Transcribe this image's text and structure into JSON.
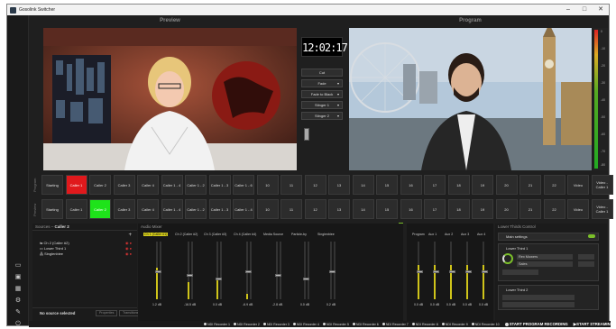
{
  "window": {
    "title": "Gosolink Switcher"
  },
  "controls": {
    "minimize": "–",
    "maximize": "□",
    "close": "✕"
  },
  "panels": {
    "preview": "Preview",
    "program": "Program"
  },
  "clock": "12:02:17",
  "transitions": [
    {
      "label": "Cut",
      "dropdown": false
    },
    {
      "label": "Fade",
      "dropdown": true
    },
    {
      "label": "Fade to Black",
      "dropdown": true
    },
    {
      "label": "Stinger 1",
      "dropdown": true
    },
    {
      "label": "Stinger 2",
      "dropdown": true
    }
  ],
  "vu_ticks": [
    "0",
    "-10",
    "-20",
    "-30",
    "-40",
    "-50",
    "-60",
    "-70",
    "-80"
  ],
  "bus_labels": {
    "program": "Program",
    "preview": "Preview"
  },
  "program_bus": [
    "Starting",
    "Caller 1",
    "Caller 2",
    "Caller 3",
    "Caller 4",
    "Caller 1 - 4",
    "Caller 1 - 2",
    "Caller 1 - 3",
    "Caller 1 - 6",
    "10",
    "11",
    "12",
    "13",
    "14",
    "15",
    "16",
    "17",
    "18",
    "19",
    "20",
    "21",
    "22",
    "Video",
    "Video - Caller 1"
  ],
  "preview_bus": [
    "Starting",
    "Caller 1",
    "Caller 2",
    "Caller 3",
    "Caller 4",
    "Caller 1 - 4",
    "Caller 1 - 2",
    "Caller 1 - 3",
    "Caller 1 - 4",
    "10",
    "11",
    "12",
    "13",
    "14",
    "15",
    "16",
    "17",
    "18",
    "19",
    "20",
    "21",
    "22",
    "Video",
    "Video - Caller 1"
  ],
  "active": {
    "program_index": 1,
    "preview_index": 2,
    "colors": {
      "program": "#e0191c",
      "preview": "#1ee31a"
    }
  },
  "sources": {
    "header": "Sources – ",
    "scene": "Caller 2",
    "add": "+",
    "items": [
      "Ch 2 (Caller #2)",
      "Lower Third 1",
      "Singlenbiee"
    ]
  },
  "no_source": "No source selected",
  "prop_buttons": [
    "Properties",
    "Transitions"
  ],
  "mixer": {
    "header": "Audio Mixer",
    "channels": [
      {
        "name": "Ch 1 (Caller #1)",
        "db": "1.2 dB",
        "level": 0.55
      },
      {
        "name": "Ch 2 (Caller #2)",
        "db": "-16.5 dB",
        "level": 0.3
      },
      {
        "name": "Ch 3 (Caller #3)",
        "db": "0.0 dB",
        "level": 0.35
      },
      {
        "name": "Ch 4 (Caller #4)",
        "db": "-6.9 dB",
        "level": 0.1
      },
      {
        "name": "Media Source",
        "db": "-2.8 dB",
        "level": 0
      },
      {
        "name": "Particle-by",
        "db": "0.0 dB",
        "level": 0
      },
      {
        "name": "Singlenbiee",
        "db": "0.2 dB",
        "level": 0
      }
    ]
  },
  "outputs": {
    "channels": [
      {
        "name": "Program",
        "db": "0.0 dB",
        "level": 0.6
      },
      {
        "name": "Aux 1",
        "db": "0.0 dB",
        "level": 0.6
      },
      {
        "name": "Aux 2",
        "db": "0.0 dB",
        "level": 0.6
      },
      {
        "name": "Aux 3",
        "db": "0.0 dB",
        "level": 0.6
      },
      {
        "name": "Aux 4",
        "db": "0.0 dB",
        "level": 0.6
      }
    ]
  },
  "lower_third": {
    "header": "Lower Thirds Control",
    "main": "Main settings",
    "blocks": [
      {
        "title": "Lower Third 1",
        "line1": "Rex Mowers",
        "line2": "Sales"
      },
      {
        "title": "Lower Third 2",
        "line1": "",
        "line2": ""
      }
    ]
  },
  "status": {
    "recorders": [
      "NDI Recorder 1",
      "NDI Recorder 2",
      "NDI Recorder 3",
      "NDI Recorder 4",
      "NDI Recorder 5",
      "NDI Recorder 6",
      "NDI Recorder 7",
      "NDI Recorder 8",
      "NDI Recorder 9",
      "NDI Recorder 10"
    ],
    "start_recording": "START PROGRAM RECORDING",
    "start_streaming": "START STREAMING"
  }
}
